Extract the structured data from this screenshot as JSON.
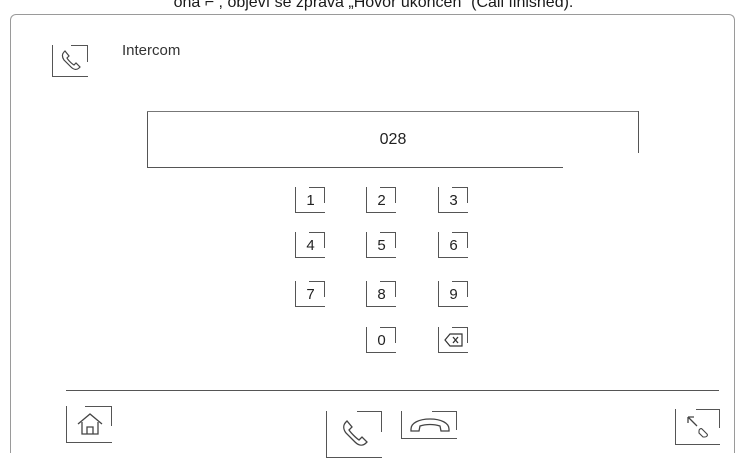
{
  "caption": "ona ⌐ , objeví se zpráva „Hovor ukončen“ (Call finished).",
  "header": {
    "title": "Intercom",
    "icon": "handset-icon"
  },
  "display": {
    "value": "028"
  },
  "keypad": {
    "keys": [
      "1",
      "2",
      "3",
      "4",
      "5",
      "6",
      "7",
      "8",
      "9",
      "0"
    ],
    "backspace_icon": "backspace-icon"
  },
  "footer": {
    "home_icon": "home-icon",
    "call_icon": "call-icon",
    "hangup_icon": "hang-up-icon",
    "fullscreen_icon": "expand-icon"
  }
}
